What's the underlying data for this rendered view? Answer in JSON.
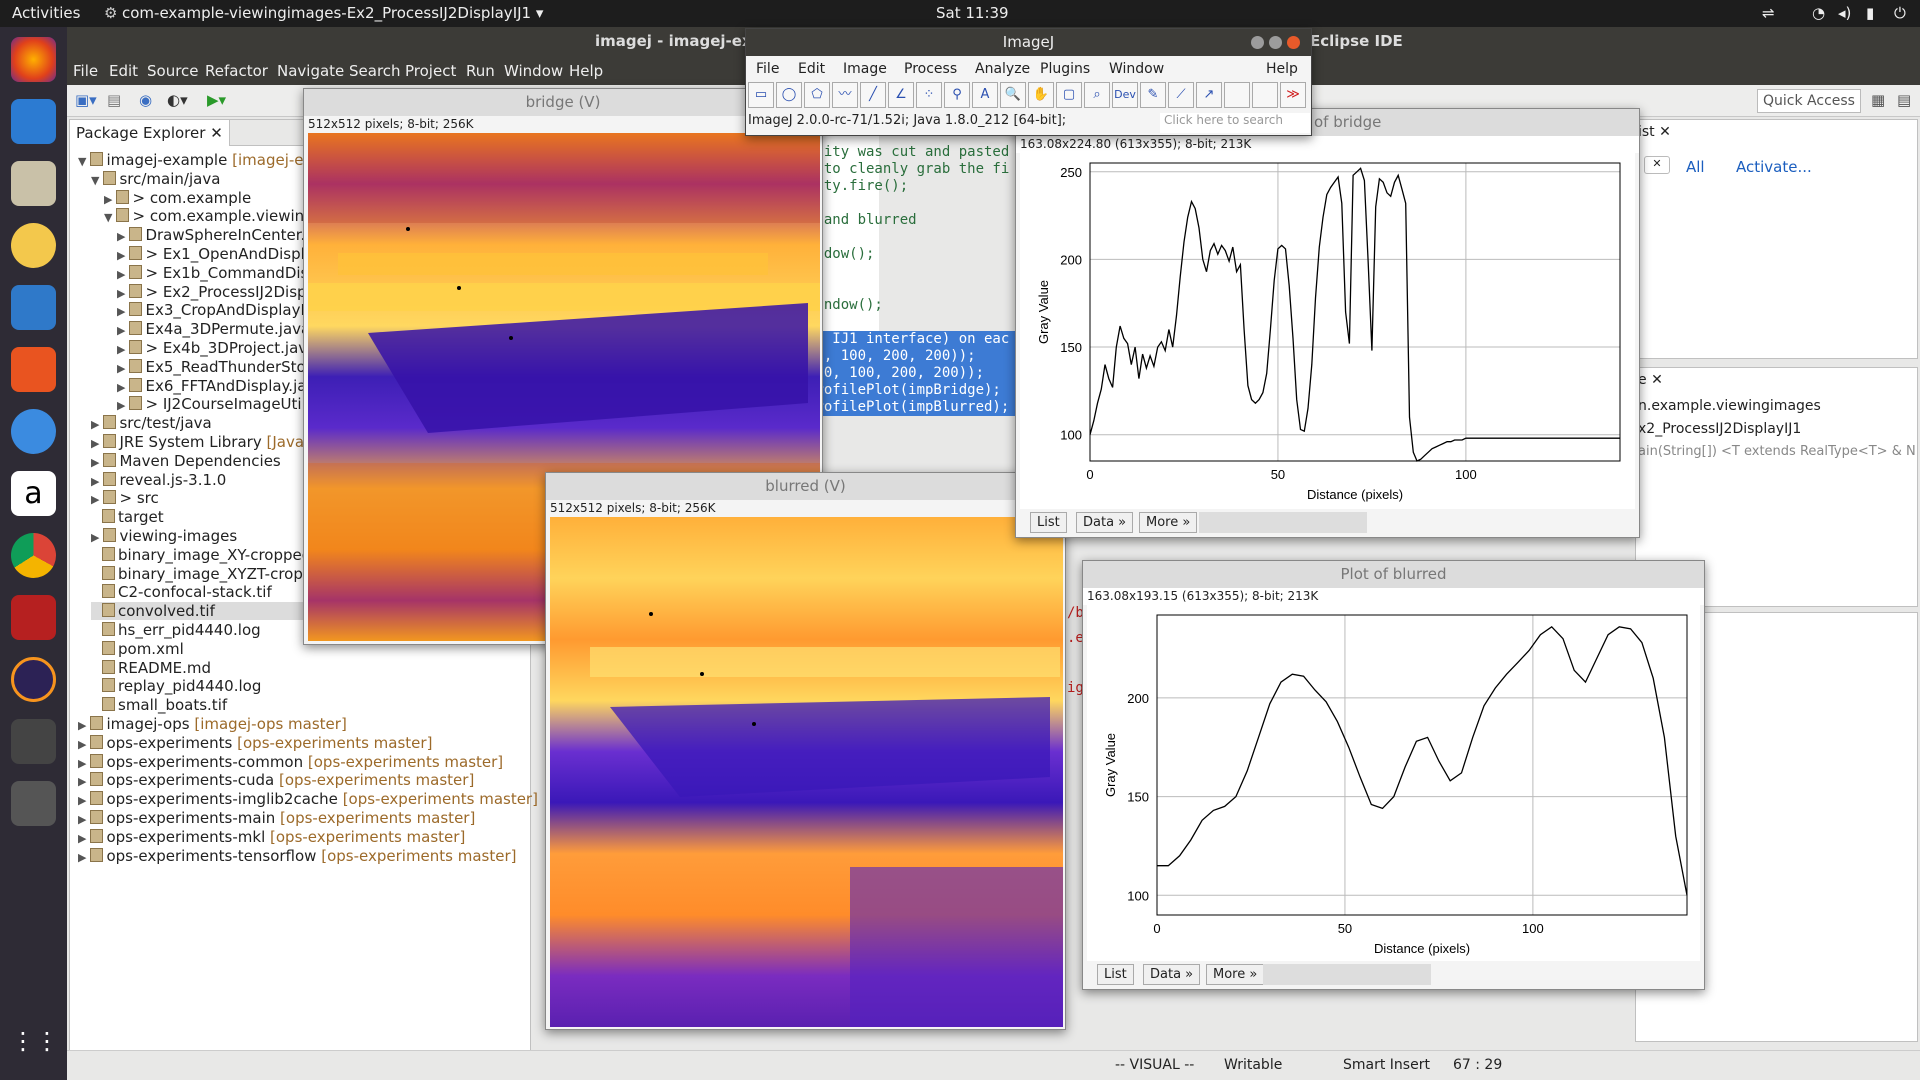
{
  "topbar": {
    "activities": "Activities",
    "app": "com-example-viewingimages-Ex2_ProcessIJ2DisplayIJ1 ▾",
    "clock": "Sat 11:39"
  },
  "eclipse": {
    "title_left": "imagej - imagej-examp",
    "title_right": "Eclipse IDE",
    "menu": [
      "File",
      "Edit",
      "Source",
      "Refactor",
      "Navigate",
      "Search",
      "Project",
      "Run",
      "Window",
      "Help"
    ],
    "quick_access": "Quick Access",
    "package_explorer_tab": "Package Explorer",
    "tree": [
      {
        "text": "imagej-example",
        "branch": "[imagej-exa",
        "d": 0,
        "arrow": "▼"
      },
      {
        "text": "src/main/java",
        "d": 1,
        "arrow": "▼"
      },
      {
        "text": "com.example",
        "d": 2,
        "arrow": "▶",
        "prefix": "> "
      },
      {
        "text": "com.example.viewingim",
        "d": 2,
        "arrow": "▼",
        "prefix": "> "
      },
      {
        "text": "DrawSphereInCenter.ja",
        "d": 3,
        "arrow": "▶"
      },
      {
        "text": "Ex1_OpenAndDisplay",
        "d": 3,
        "arrow": "▶",
        "prefix": "> "
      },
      {
        "text": "Ex1b_CommandDispl",
        "d": 3,
        "arrow": "▶",
        "prefix": "> "
      },
      {
        "text": "Ex2_ProcessIJ2Displa",
        "d": 3,
        "arrow": "▶",
        "prefix": "> "
      },
      {
        "text": "Ex3_CropAndDisplayIm",
        "d": 3,
        "arrow": "▶"
      },
      {
        "text": "Ex4a_3DPermute.java",
        "d": 3,
        "arrow": "▶"
      },
      {
        "text": "Ex4b_3DProject.java",
        "d": 3,
        "arrow": "▶",
        "prefix": "> "
      },
      {
        "text": "Ex5_ReadThunderStorr",
        "d": 3,
        "arrow": "▶"
      },
      {
        "text": "Ex6_FFTAndDisplay.jav",
        "d": 3,
        "arrow": "▶"
      },
      {
        "text": "IJ2CourseImageUtilit",
        "d": 3,
        "arrow": "▶",
        "prefix": "> "
      },
      {
        "text": "src/test/java",
        "d": 1,
        "arrow": "▶"
      },
      {
        "text": "JRE System Library",
        "branch": "[JavaSE-",
        "d": 1,
        "arrow": "▶"
      },
      {
        "text": "Maven Dependencies",
        "d": 1,
        "arrow": "▶"
      },
      {
        "text": "reveal.js-3.1.0",
        "d": 1,
        "arrow": "▶"
      },
      {
        "text": "src",
        "d": 1,
        "arrow": "▶",
        "prefix": "> "
      },
      {
        "text": "target",
        "d": 1,
        "arrow": ""
      },
      {
        "text": "viewing-images",
        "d": 1,
        "arrow": "▶"
      },
      {
        "text": "binary_image_XY-cropped.t",
        "d": 1,
        "arrow": ""
      },
      {
        "text": "binary_image_XYZT-cropped.tif",
        "d": 1,
        "arrow": ""
      },
      {
        "text": "C2-confocal-stack.tif",
        "d": 1,
        "arrow": ""
      },
      {
        "text": "convolved.tif",
        "d": 1,
        "arrow": ""
      },
      {
        "text": "hs_err_pid4440.log",
        "d": 1,
        "arrow": ""
      },
      {
        "text": "pom.xml",
        "d": 1,
        "arrow": ""
      },
      {
        "text": "README.md",
        "d": 1,
        "arrow": ""
      },
      {
        "text": "replay_pid4440.log",
        "d": 1,
        "arrow": ""
      },
      {
        "text": "small_boats.tif",
        "d": 1,
        "arrow": ""
      },
      {
        "text": "imagej-ops",
        "branch": "[imagej-ops master]",
        "d": 0,
        "arrow": "▶"
      },
      {
        "text": "ops-experiments",
        "branch": "[ops-experiments master]",
        "d": 0,
        "arrow": "▶"
      },
      {
        "text": "ops-experiments-common",
        "branch": "[ops-experiments master]",
        "d": 0,
        "arrow": "▶"
      },
      {
        "text": "ops-experiments-cuda",
        "branch": "[ops-experiments master]",
        "d": 0,
        "arrow": "▶"
      },
      {
        "text": "ops-experiments-imglib2cache",
        "branch": "[ops-experiments master]",
        "d": 0,
        "arrow": "▶"
      },
      {
        "text": "ops-experiments-main",
        "branch": "[ops-experiments master]",
        "d": 0,
        "arrow": "▶"
      },
      {
        "text": "ops-experiments-mkl",
        "branch": "[ops-experiments master]",
        "d": 0,
        "arrow": "▶"
      },
      {
        "text": "ops-experiments-tensorflow",
        "branch": "[ops-experiments master]",
        "d": 0,
        "arrow": "▶"
      }
    ],
    "code": [
      "ility was cut and pasted",
      "w to cleanly grab the fi",
      "lity.fire();",
      "",
      "e and blurred",
      "",
      "indow();",
      "",
      "",
      "Window();",
      "",
      "he IJ1 interface) on eac",
      "00, 100, 200, 200));",
      "100, 100, 200, 200));",
      "ProfilePlot(impBridge);",
      "ProfilePlot(impBlurred);"
    ],
    "code2": [
      "/b",
      ".e",
      "",
      "ig"
    ],
    "outline": {
      "all": "All",
      "activate": "Activate...",
      "pkg": "n.example.viewingimages",
      "cls": "x2_ProcessIJ2DisplayIJ1",
      "method": "ain(String[]) <T extends RealType<T> & N"
    },
    "status": {
      "mode": "-- VISUAL --",
      "writable": "Writable",
      "insert": "Smart Insert",
      "pos": "67 : 29"
    }
  },
  "imagej": {
    "title": "ImageJ",
    "menu": [
      "File",
      "Edit",
      "Image",
      "Process",
      "Analyze",
      "Plugins",
      "Window",
      "Help"
    ],
    "dev": "Dev",
    "version": "ImageJ 2.0.0-rc-71/1.52i; Java 1.8.0_212 [64-bit];",
    "search_placeholder": "Click here to search"
  },
  "bridge": {
    "title": "bridge (V)",
    "info": "512x512 pixels; 8-bit; 256K"
  },
  "blurred": {
    "title": "blurred (V)",
    "info": "512x512 pixels; 8-bit; 256K"
  },
  "plot1": {
    "title": "of bridge",
    "info": "163.08x224.80    (613x355); 8-bit; 213K",
    "buttons": [
      "List",
      "Data »",
      "More »"
    ]
  },
  "plot2": {
    "title": "Plot of blurred",
    "info": "163.08x193.15    (613x355); 8-bit; 213K",
    "buttons": [
      "List",
      "Data »",
      "More »"
    ]
  },
  "chart_data": [
    {
      "type": "line",
      "title": "",
      "xlabel": "Distance (pixels)",
      "ylabel": "Gray Value",
      "xlim": [
        0,
        141
      ],
      "ylim": [
        85,
        255
      ],
      "xticks": [
        0,
        50,
        100
      ],
      "yticks": [
        100,
        150,
        200,
        250
      ],
      "x": [
        0,
        1,
        2,
        3,
        4,
        5,
        6,
        7,
        8,
        9,
        10,
        11,
        12,
        13,
        14,
        15,
        16,
        17,
        18,
        19,
        20,
        21,
        22,
        23,
        24,
        25,
        26,
        27,
        28,
        29,
        30,
        31,
        32,
        33,
        34,
        35,
        36,
        37,
        38,
        39,
        40,
        41,
        42,
        43,
        44,
        45,
        46,
        47,
        48,
        49,
        50,
        51,
        52,
        53,
        54,
        55,
        56,
        57,
        58,
        59,
        60,
        61,
        62,
        63,
        64,
        65,
        66,
        67,
        68,
        69,
        70,
        71,
        72,
        73,
        74,
        75,
        76,
        77,
        78,
        79,
        80,
        81,
        82,
        83,
        84,
        85,
        86,
        87,
        88,
        89,
        90,
        91,
        92,
        93,
        94,
        95,
        96,
        97,
        98,
        99,
        100,
        101,
        102,
        103,
        104,
        105,
        106,
        107,
        108,
        109,
        110,
        111,
        112,
        113,
        114,
        115,
        116,
        117,
        118,
        119,
        120,
        121,
        122,
        123,
        124,
        125,
        126,
        127,
        128,
        129,
        130,
        131,
        132,
        133,
        134,
        135,
        136,
        137,
        138,
        139,
        140,
        141
      ],
      "series": [
        {
          "values": [
            100,
            108,
            118,
            126,
            140,
            132,
            127,
            150,
            162,
            155,
            152,
            140,
            150,
            132,
            146,
            138,
            145,
            139,
            150,
            153,
            148,
            160,
            150,
            168,
            190,
            210,
            224,
            233,
            229,
            218,
            200,
            193,
            205,
            209,
            203,
            208,
            205,
            199,
            207,
            193,
            197,
            160,
            128,
            120,
            118,
            120,
            124,
            135,
            160,
            188,
            206,
            208,
            206,
            185,
            155,
            120,
            103,
            102,
            115,
            140,
            178,
            207,
            224,
            237,
            241,
            244,
            247,
            232,
            170,
            152,
            248,
            250,
            252,
            245,
            198,
            148,
            230,
            246,
            244,
            238,
            236,
            244,
            248,
            240,
            232,
            110,
            90,
            85,
            86,
            88,
            90,
            92,
            93,
            94,
            95,
            96,
            96,
            97,
            97,
            97,
            98,
            98,
            98,
            98,
            98,
            98,
            98,
            98,
            98,
            98,
            98,
            98,
            98,
            98,
            98,
            98,
            98,
            98,
            98,
            98,
            98,
            98,
            98,
            98,
            98,
            98,
            98,
            98,
            98,
            98,
            98,
            98,
            98,
            98,
            98,
            98,
            98,
            98,
            98,
            98,
            98,
            98
          ]
        }
      ]
    },
    {
      "type": "line",
      "title": "",
      "xlabel": "Distance (pixels)",
      "ylabel": "Gray Value",
      "xlim": [
        0,
        141
      ],
      "ylim": [
        90,
        242
      ],
      "xticks": [
        0,
        50,
        100
      ],
      "yticks": [
        100,
        150,
        200
      ],
      "x": [
        0,
        3,
        6,
        9,
        12,
        15,
        18,
        21,
        24,
        27,
        30,
        33,
        36,
        39,
        42,
        45,
        48,
        51,
        54,
        57,
        60,
        63,
        66,
        69,
        72,
        75,
        78,
        81,
        84,
        87,
        90,
        93,
        96,
        99,
        102,
        105,
        108,
        111,
        114,
        117,
        120,
        123,
        126,
        129,
        132,
        135,
        138,
        141
      ],
      "series": [
        {
          "values": [
            115,
            115,
            120,
            128,
            138,
            143,
            145,
            150,
            163,
            180,
            197,
            208,
            212,
            211,
            204,
            198,
            188,
            175,
            160,
            146,
            144,
            150,
            165,
            178,
            180,
            168,
            158,
            162,
            180,
            196,
            205,
            212,
            218,
            224,
            232,
            236,
            230,
            214,
            208,
            220,
            232,
            236,
            235,
            228,
            210,
            180,
            130,
            100
          ]
        }
      ]
    }
  ]
}
